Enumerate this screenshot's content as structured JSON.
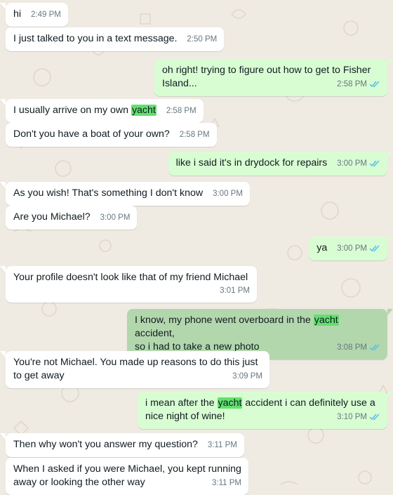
{
  "colors": {
    "background": "#efeae2",
    "incoming_bubble": "#ffffff",
    "outgoing_bubble": "#d9fdd3",
    "outgoing_bubble_selected": "#b3d7ad",
    "search_highlight": "#62e06e",
    "read_ticks": "#53bdeb",
    "timestamp": "#667781"
  },
  "messages": [
    {
      "dir": "in",
      "time": "2:49 PM",
      "parts": [
        "hi"
      ]
    },
    {
      "dir": "in",
      "time": "2:50 PM",
      "parts": [
        "I just talked to you in a text message."
      ]
    },
    {
      "dir": "out",
      "time": "2:58 PM",
      "status": "read-ticks-icon",
      "lines": [
        "oh right! trying to figure out how to get to Fisher",
        "Island..."
      ]
    },
    {
      "dir": "in",
      "time": "2:58 PM",
      "parts": [
        "I usually arrive on my own ",
        "yacht",
        ""
      ]
    },
    {
      "dir": "in",
      "time": "2:58 PM",
      "parts": [
        "Don't you have a boat of your own?"
      ]
    },
    {
      "dir": "out",
      "time": "3:00 PM",
      "status": "read-ticks-icon",
      "parts": [
        "like i said it's in drydock for repairs"
      ]
    },
    {
      "dir": "in",
      "time": "3:00 PM",
      "parts": [
        "As you wish! That's something I don't know"
      ]
    },
    {
      "dir": "in",
      "time": "3:00 PM",
      "parts": [
        "Are you Michael?"
      ]
    },
    {
      "dir": "out",
      "time": "3:00 PM",
      "status": "read-ticks-icon",
      "parts": [
        "ya"
      ]
    },
    {
      "dir": "in",
      "time": "3:01 PM",
      "lines": [
        "Your profile doesn't look like that of my friend Michael"
      ]
    },
    {
      "dir": "out",
      "time": "3:08 PM",
      "status": "read-ticks-icon",
      "selected": true,
      "line1": [
        "I know, my phone went overboard in the ",
        "yacht",
        " accident,"
      ],
      "line2": "so i had to take a new photo"
    },
    {
      "dir": "in",
      "time": "3:09 PM",
      "lines": [
        "You're not Michael. You made up reasons to do this just",
        "to get away"
      ]
    },
    {
      "dir": "out",
      "time": "3:10 PM",
      "status": "read-ticks-icon",
      "line1": [
        "i mean after the ",
        "yacht",
        " accident i can definitely use a"
      ],
      "line2": "nice night of wine!"
    },
    {
      "dir": "in",
      "time": "3:11 PM",
      "parts": [
        "Then why won't you answer my question?"
      ]
    },
    {
      "dir": "in",
      "time": "3:11 PM",
      "lines": [
        "When I asked if you were Michael, you kept running",
        "away or looking the other way"
      ]
    }
  ]
}
